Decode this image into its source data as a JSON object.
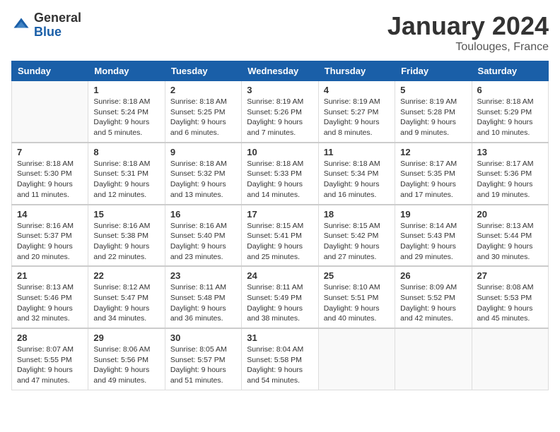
{
  "logo": {
    "general": "General",
    "blue": "Blue"
  },
  "title": {
    "month": "January 2024",
    "location": "Toulouges, France"
  },
  "weekdays": [
    "Sunday",
    "Monday",
    "Tuesday",
    "Wednesday",
    "Thursday",
    "Friday",
    "Saturday"
  ],
  "weeks": [
    [
      {
        "day": "",
        "info": ""
      },
      {
        "day": "1",
        "info": "Sunrise: 8:18 AM\nSunset: 5:24 PM\nDaylight: 9 hours\nand 5 minutes."
      },
      {
        "day": "2",
        "info": "Sunrise: 8:18 AM\nSunset: 5:25 PM\nDaylight: 9 hours\nand 6 minutes."
      },
      {
        "day": "3",
        "info": "Sunrise: 8:19 AM\nSunset: 5:26 PM\nDaylight: 9 hours\nand 7 minutes."
      },
      {
        "day": "4",
        "info": "Sunrise: 8:19 AM\nSunset: 5:27 PM\nDaylight: 9 hours\nand 8 minutes."
      },
      {
        "day": "5",
        "info": "Sunrise: 8:19 AM\nSunset: 5:28 PM\nDaylight: 9 hours\nand 9 minutes."
      },
      {
        "day": "6",
        "info": "Sunrise: 8:18 AM\nSunset: 5:29 PM\nDaylight: 9 hours\nand 10 minutes."
      }
    ],
    [
      {
        "day": "7",
        "info": "Sunrise: 8:18 AM\nSunset: 5:30 PM\nDaylight: 9 hours\nand 11 minutes."
      },
      {
        "day": "8",
        "info": "Sunrise: 8:18 AM\nSunset: 5:31 PM\nDaylight: 9 hours\nand 12 minutes."
      },
      {
        "day": "9",
        "info": "Sunrise: 8:18 AM\nSunset: 5:32 PM\nDaylight: 9 hours\nand 13 minutes."
      },
      {
        "day": "10",
        "info": "Sunrise: 8:18 AM\nSunset: 5:33 PM\nDaylight: 9 hours\nand 14 minutes."
      },
      {
        "day": "11",
        "info": "Sunrise: 8:18 AM\nSunset: 5:34 PM\nDaylight: 9 hours\nand 16 minutes."
      },
      {
        "day": "12",
        "info": "Sunrise: 8:17 AM\nSunset: 5:35 PM\nDaylight: 9 hours\nand 17 minutes."
      },
      {
        "day": "13",
        "info": "Sunrise: 8:17 AM\nSunset: 5:36 PM\nDaylight: 9 hours\nand 19 minutes."
      }
    ],
    [
      {
        "day": "14",
        "info": "Sunrise: 8:16 AM\nSunset: 5:37 PM\nDaylight: 9 hours\nand 20 minutes."
      },
      {
        "day": "15",
        "info": "Sunrise: 8:16 AM\nSunset: 5:38 PM\nDaylight: 9 hours\nand 22 minutes."
      },
      {
        "day": "16",
        "info": "Sunrise: 8:16 AM\nSunset: 5:40 PM\nDaylight: 9 hours\nand 23 minutes."
      },
      {
        "day": "17",
        "info": "Sunrise: 8:15 AM\nSunset: 5:41 PM\nDaylight: 9 hours\nand 25 minutes."
      },
      {
        "day": "18",
        "info": "Sunrise: 8:15 AM\nSunset: 5:42 PM\nDaylight: 9 hours\nand 27 minutes."
      },
      {
        "day": "19",
        "info": "Sunrise: 8:14 AM\nSunset: 5:43 PM\nDaylight: 9 hours\nand 29 minutes."
      },
      {
        "day": "20",
        "info": "Sunrise: 8:13 AM\nSunset: 5:44 PM\nDaylight: 9 hours\nand 30 minutes."
      }
    ],
    [
      {
        "day": "21",
        "info": "Sunrise: 8:13 AM\nSunset: 5:46 PM\nDaylight: 9 hours\nand 32 minutes."
      },
      {
        "day": "22",
        "info": "Sunrise: 8:12 AM\nSunset: 5:47 PM\nDaylight: 9 hours\nand 34 minutes."
      },
      {
        "day": "23",
        "info": "Sunrise: 8:11 AM\nSunset: 5:48 PM\nDaylight: 9 hours\nand 36 minutes."
      },
      {
        "day": "24",
        "info": "Sunrise: 8:11 AM\nSunset: 5:49 PM\nDaylight: 9 hours\nand 38 minutes."
      },
      {
        "day": "25",
        "info": "Sunrise: 8:10 AM\nSunset: 5:51 PM\nDaylight: 9 hours\nand 40 minutes."
      },
      {
        "day": "26",
        "info": "Sunrise: 8:09 AM\nSunset: 5:52 PM\nDaylight: 9 hours\nand 42 minutes."
      },
      {
        "day": "27",
        "info": "Sunrise: 8:08 AM\nSunset: 5:53 PM\nDaylight: 9 hours\nand 45 minutes."
      }
    ],
    [
      {
        "day": "28",
        "info": "Sunrise: 8:07 AM\nSunset: 5:55 PM\nDaylight: 9 hours\nand 47 minutes."
      },
      {
        "day": "29",
        "info": "Sunrise: 8:06 AM\nSunset: 5:56 PM\nDaylight: 9 hours\nand 49 minutes."
      },
      {
        "day": "30",
        "info": "Sunrise: 8:05 AM\nSunset: 5:57 PM\nDaylight: 9 hours\nand 51 minutes."
      },
      {
        "day": "31",
        "info": "Sunrise: 8:04 AM\nSunset: 5:58 PM\nDaylight: 9 hours\nand 54 minutes."
      },
      {
        "day": "",
        "info": ""
      },
      {
        "day": "",
        "info": ""
      },
      {
        "day": "",
        "info": ""
      }
    ]
  ]
}
